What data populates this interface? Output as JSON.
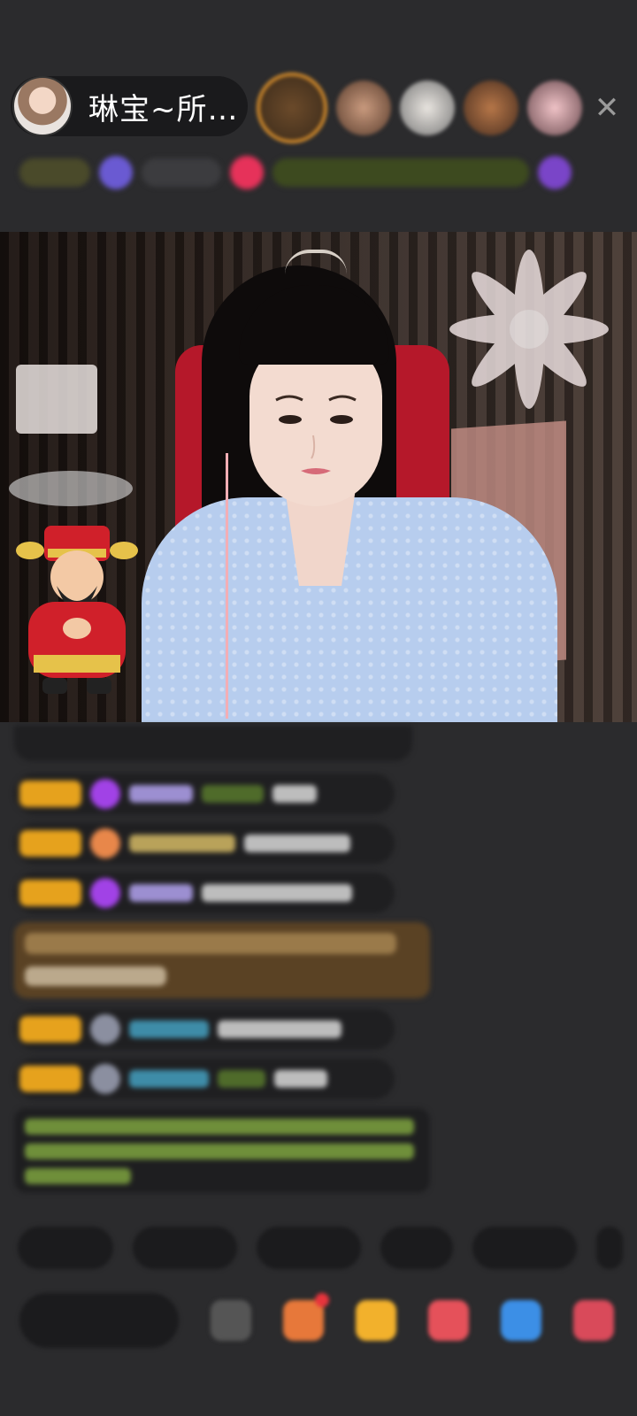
{
  "host": {
    "name": "琳宝~所…"
  },
  "icons": {
    "close": "close-icon",
    "avatar": "avatar"
  },
  "colors": {
    "background": "#2b2b2d",
    "badge": "#e6a21d",
    "chair": "#b5182a"
  }
}
